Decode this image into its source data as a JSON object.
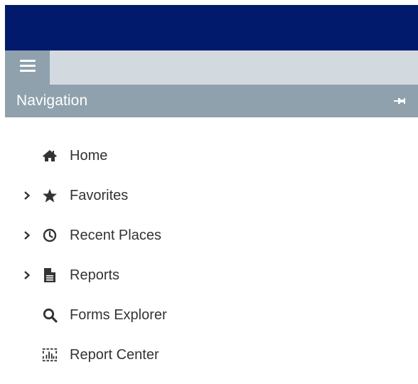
{
  "toolbar": {
    "menu_icon": "hamburger-menu-icon"
  },
  "navigation": {
    "title": "Navigation",
    "pin_icon": "pin-icon",
    "items": [
      {
        "label": "Home",
        "icon": "home-icon",
        "expandable": false
      },
      {
        "label": "Favorites",
        "icon": "star-icon",
        "expandable": true
      },
      {
        "label": "Recent Places",
        "icon": "clock-icon",
        "expandable": true
      },
      {
        "label": "Reports",
        "icon": "document-icon",
        "expandable": true
      },
      {
        "label": "Forms Explorer",
        "icon": "search-icon",
        "expandable": false
      },
      {
        "label": "Report Center",
        "icon": "report-center-icon",
        "expandable": false
      }
    ]
  },
  "colors": {
    "top_bar": "#021a6b",
    "toolbar": "#d2d9df",
    "header": "#8ea1ad",
    "text": "#333333"
  }
}
